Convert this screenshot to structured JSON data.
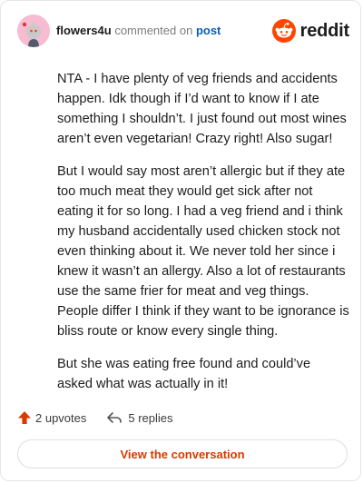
{
  "comment": {
    "username": "flowers4u",
    "action_text": "commented on",
    "post_link": "post",
    "brand": "reddit",
    "paragraphs": [
      "NTA - I have plenty of veg friends and accidents happen. Idk though if I’d want to know if I ate something I shouldn’t. I just found out most wines aren’t even vegetarian! Crazy right! Also sugar!",
      "But I would say most aren’t allergic but if they ate too much meat they would get sick after not eating it for so long. I had a veg friend and i think my husband accidentally used chicken stock not even thinking about it. We never told her since i knew it wasn’t an allergy. Also a lot of restaurants use the same frier for meat and veg things. People differ I think if they want to be ignorance is bliss route or know every single thing.",
      "But she was eating free found and could’ve asked what was actually in it!"
    ],
    "upvotes": "2 upvotes",
    "replies": "5 replies",
    "cta": "View the conversation"
  },
  "colors": {
    "brand_orange": "#ff4500",
    "upvote_orange": "#d93a00",
    "link_blue": "#0b5fb3",
    "avatar_bg": "#f7bcd1"
  },
  "icons": {
    "avatar": "snoo-avatar",
    "logo": "reddit-snoo-icon",
    "upvote": "upvote-arrow-icon",
    "reply": "reply-arrow-icon"
  }
}
